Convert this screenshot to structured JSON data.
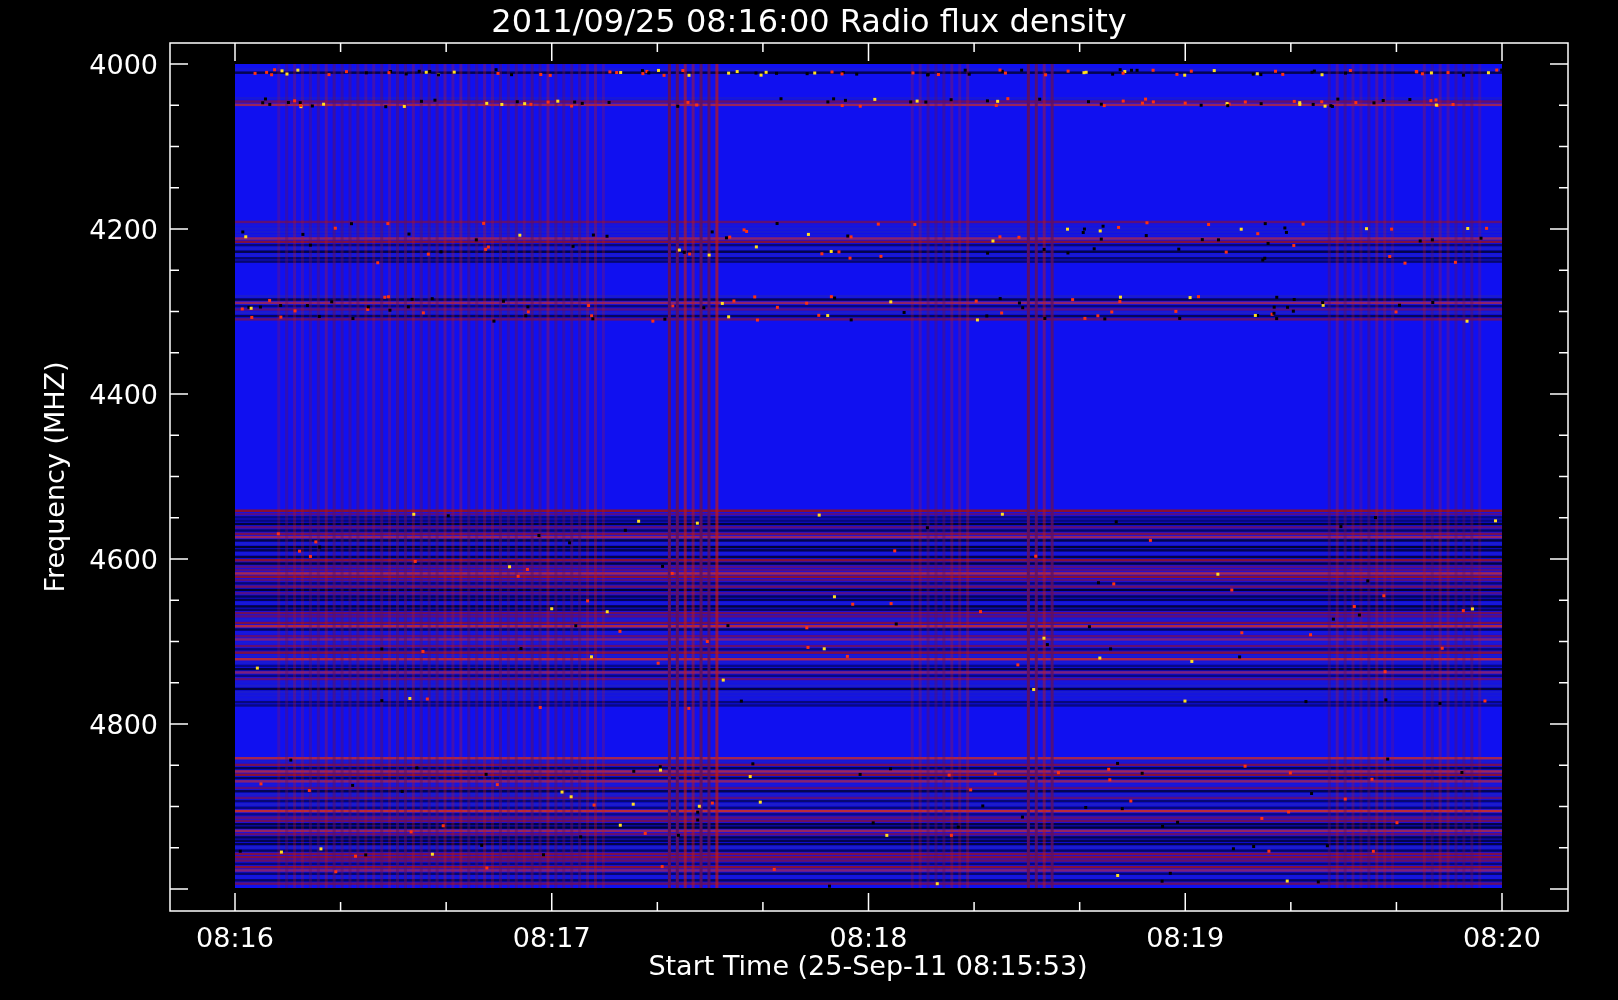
{
  "plot": {
    "title": "2011/09/25 08:16:00 Radio flux density",
    "ylabel": "Frequency (MHZ)",
    "xlabel": "Start Time (25-Sep-11 08:15:53)",
    "ytick_labels": [
      "4000",
      "4200",
      "4400",
      "4600",
      "4800"
    ],
    "xtick_labels": [
      "08:16",
      "08:17",
      "08:18",
      "08:19",
      "08:20"
    ]
  }
}
